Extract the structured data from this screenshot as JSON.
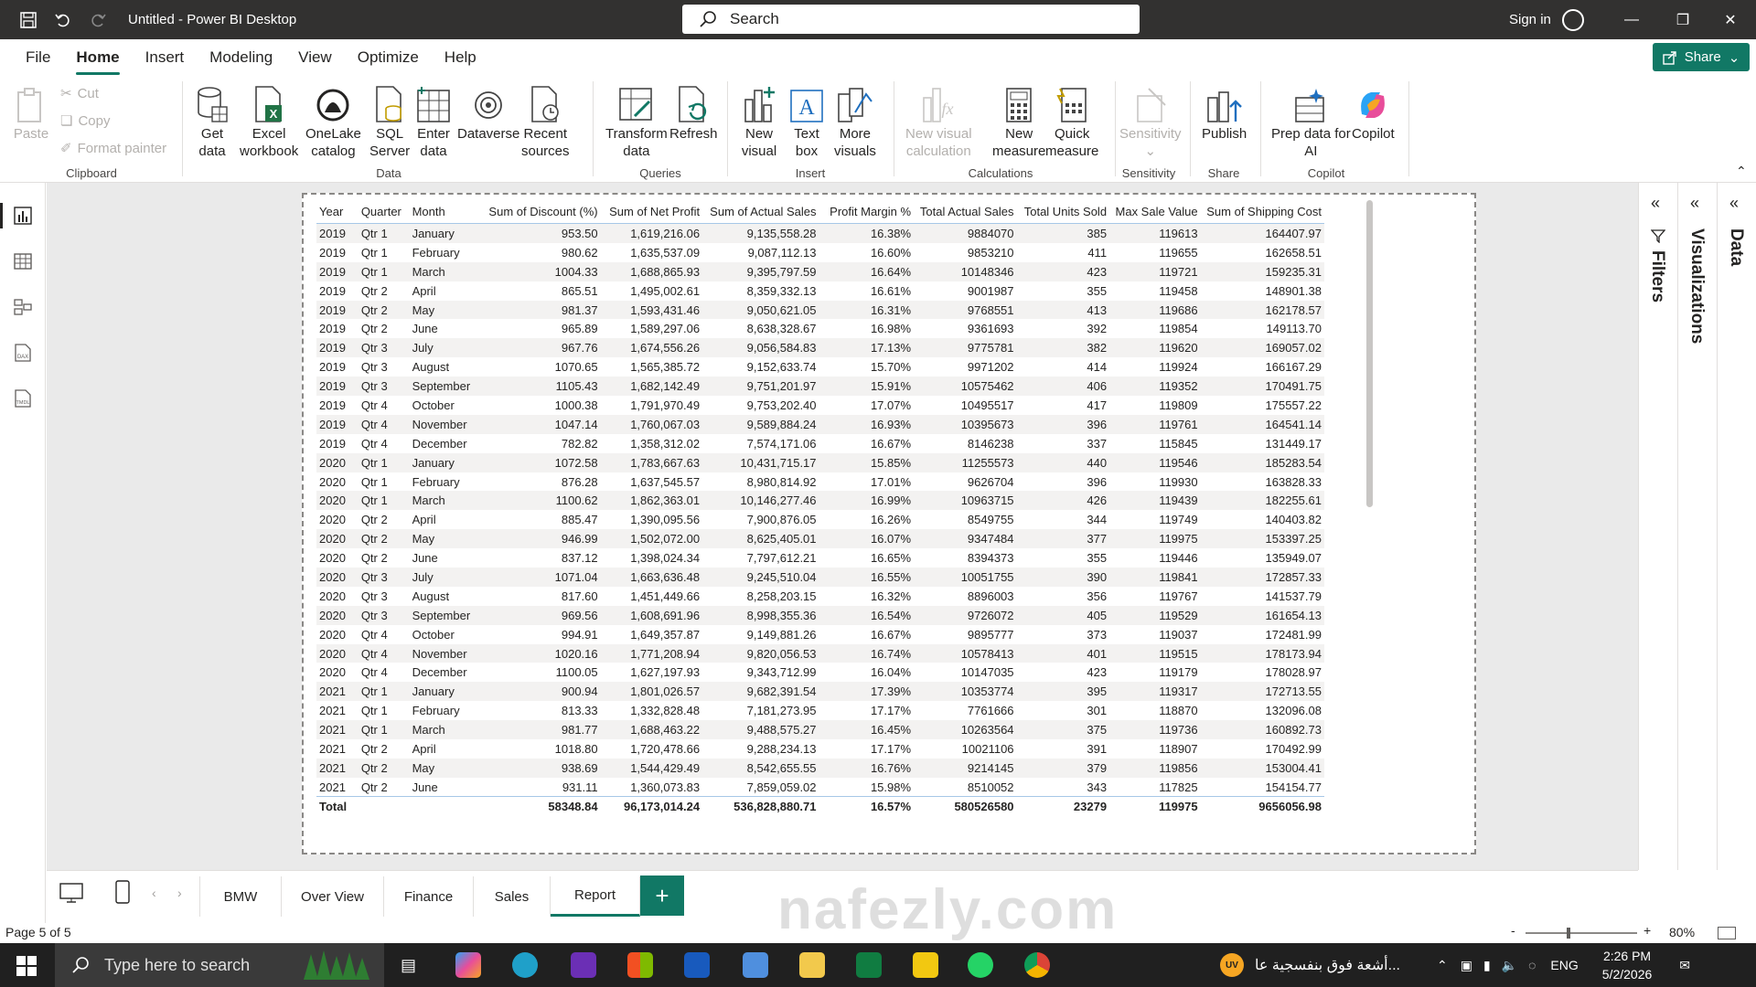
{
  "titlebar": {
    "title": "Untitled - Power BI Desktop",
    "search_placeholder": "Search",
    "signin": "Sign in"
  },
  "menu": {
    "items": [
      "File",
      "Home",
      "Insert",
      "Modeling",
      "View",
      "Optimize",
      "Help"
    ],
    "share": "Share"
  },
  "ribbon": {
    "clipboard": {
      "paste": "Paste",
      "cut": "Cut",
      "copy": "Copy",
      "format_painter": "Format painter",
      "label": "Clipboard"
    },
    "data": {
      "get_data": [
        "Get",
        "data"
      ],
      "excel": [
        "Excel",
        "workbook"
      ],
      "onelake": [
        "OneLake",
        "catalog"
      ],
      "sql": [
        "SQL",
        "Server"
      ],
      "enter": [
        "Enter",
        "data"
      ],
      "dataverse": "Dataverse",
      "recent": [
        "Recent",
        "sources"
      ],
      "label": "Data"
    },
    "queries": {
      "transform": [
        "Transform",
        "data"
      ],
      "refresh": "Refresh",
      "label": "Queries"
    },
    "insert": {
      "new_visual": [
        "New",
        "visual"
      ],
      "text_box": [
        "Text",
        "box"
      ],
      "more_visuals": [
        "More",
        "visuals"
      ],
      "label": "Insert"
    },
    "calculations": {
      "new_visual_calc": [
        "New visual",
        "calculation"
      ],
      "new_measure": [
        "New",
        "measure"
      ],
      "quick_measure": [
        "Quick",
        "measure"
      ],
      "label": "Calculations"
    },
    "sensitivity": {
      "btn": "Sensitivity",
      "label": "Sensitivity"
    },
    "share": {
      "publish": "Publish",
      "label": "Share"
    },
    "copilot": {
      "prep": [
        "Prep data for",
        "AI"
      ],
      "copilot": "Copilot",
      "label": "Copilot"
    }
  },
  "table": {
    "headers": [
      "Year",
      "Quarter",
      "Month",
      "Sum of Discount (%)",
      "Sum of Net Profit",
      "Sum of Actual Sales",
      "Profit Margin %",
      "Total Actual Sales",
      "Total Units Sold",
      "Max Sale Value",
      "Sum of Shipping Cost"
    ],
    "rows": [
      [
        "2019",
        "Qtr 1",
        "January",
        "953.50",
        "1,619,216.06",
        "9,135,558.28",
        "16.38%",
        "9884070",
        "385",
        "119613",
        "164407.97"
      ],
      [
        "2019",
        "Qtr 1",
        "February",
        "980.62",
        "1,635,537.09",
        "9,087,112.13",
        "16.60%",
        "9853210",
        "411",
        "119655",
        "162658.51"
      ],
      [
        "2019",
        "Qtr 1",
        "March",
        "1004.33",
        "1,688,865.93",
        "9,395,797.59",
        "16.64%",
        "10148346",
        "423",
        "119721",
        "159235.31"
      ],
      [
        "2019",
        "Qtr 2",
        "April",
        "865.51",
        "1,495,002.61",
        "8,359,332.13",
        "16.61%",
        "9001987",
        "355",
        "119458",
        "148901.38"
      ],
      [
        "2019",
        "Qtr 2",
        "May",
        "981.37",
        "1,593,431.46",
        "9,050,621.05",
        "16.31%",
        "9768551",
        "413",
        "119686",
        "162178.57"
      ],
      [
        "2019",
        "Qtr 2",
        "June",
        "965.89",
        "1,589,297.06",
        "8,638,328.67",
        "16.98%",
        "9361693",
        "392",
        "119854",
        "149113.70"
      ],
      [
        "2019",
        "Qtr 3",
        "July",
        "967.76",
        "1,674,556.26",
        "9,056,584.83",
        "17.13%",
        "9775781",
        "382",
        "119620",
        "169057.02"
      ],
      [
        "2019",
        "Qtr 3",
        "August",
        "1070.65",
        "1,565,385.72",
        "9,152,633.74",
        "15.70%",
        "9971202",
        "414",
        "119924",
        "166167.29"
      ],
      [
        "2019",
        "Qtr 3",
        "September",
        "1105.43",
        "1,682,142.49",
        "9,751,201.97",
        "15.91%",
        "10575462",
        "406",
        "119352",
        "170491.75"
      ],
      [
        "2019",
        "Qtr 4",
        "October",
        "1000.38",
        "1,791,970.49",
        "9,753,202.40",
        "17.07%",
        "10495517",
        "417",
        "119809",
        "175557.22"
      ],
      [
        "2019",
        "Qtr 4",
        "November",
        "1047.14",
        "1,760,067.03",
        "9,589,884.24",
        "16.93%",
        "10395673",
        "396",
        "119761",
        "164541.14"
      ],
      [
        "2019",
        "Qtr 4",
        "December",
        "782.82",
        "1,358,312.02",
        "7,574,171.06",
        "16.67%",
        "8146238",
        "337",
        "115845",
        "131449.17"
      ],
      [
        "2020",
        "Qtr 1",
        "January",
        "1072.58",
        "1,783,667.63",
        "10,431,715.17",
        "15.85%",
        "11255573",
        "440",
        "119546",
        "185283.54"
      ],
      [
        "2020",
        "Qtr 1",
        "February",
        "876.28",
        "1,637,545.57",
        "8,980,814.92",
        "17.01%",
        "9626704",
        "396",
        "119930",
        "163828.33"
      ],
      [
        "2020",
        "Qtr 1",
        "March",
        "1100.62",
        "1,862,363.01",
        "10,146,277.46",
        "16.99%",
        "10963715",
        "426",
        "119439",
        "182255.61"
      ],
      [
        "2020",
        "Qtr 2",
        "April",
        "885.47",
        "1,390,095.56",
        "7,900,876.05",
        "16.26%",
        "8549755",
        "344",
        "119749",
        "140403.82"
      ],
      [
        "2020",
        "Qtr 2",
        "May",
        "946.99",
        "1,502,072.00",
        "8,625,405.01",
        "16.07%",
        "9347484",
        "377",
        "119975",
        "153397.25"
      ],
      [
        "2020",
        "Qtr 2",
        "June",
        "837.12",
        "1,398,024.34",
        "7,797,612.21",
        "16.65%",
        "8394373",
        "355",
        "119446",
        "135949.07"
      ],
      [
        "2020",
        "Qtr 3",
        "July",
        "1071.04",
        "1,663,636.48",
        "9,245,510.04",
        "16.55%",
        "10051755",
        "390",
        "119841",
        "172857.33"
      ],
      [
        "2020",
        "Qtr 3",
        "August",
        "817.60",
        "1,451,449.66",
        "8,258,203.15",
        "16.32%",
        "8896003",
        "356",
        "119767",
        "141537.79"
      ],
      [
        "2020",
        "Qtr 3",
        "September",
        "969.56",
        "1,608,691.96",
        "8,998,355.36",
        "16.54%",
        "9726072",
        "405",
        "119529",
        "161654.13"
      ],
      [
        "2020",
        "Qtr 4",
        "October",
        "994.91",
        "1,649,357.87",
        "9,149,881.26",
        "16.67%",
        "9895777",
        "373",
        "119037",
        "172481.99"
      ],
      [
        "2020",
        "Qtr 4",
        "November",
        "1020.16",
        "1,771,208.94",
        "9,820,056.53",
        "16.74%",
        "10578413",
        "401",
        "119515",
        "178173.94"
      ],
      [
        "2020",
        "Qtr 4",
        "December",
        "1100.05",
        "1,627,197.93",
        "9,343,712.99",
        "16.04%",
        "10147035",
        "423",
        "119179",
        "178028.97"
      ],
      [
        "2021",
        "Qtr 1",
        "January",
        "900.94",
        "1,801,026.57",
        "9,682,391.54",
        "17.39%",
        "10353774",
        "395",
        "119317",
        "172713.55"
      ],
      [
        "2021",
        "Qtr 1",
        "February",
        "813.33",
        "1,332,828.48",
        "7,181,273.95",
        "17.17%",
        "7761666",
        "301",
        "118870",
        "132096.08"
      ],
      [
        "2021",
        "Qtr 1",
        "March",
        "981.77",
        "1,688,463.22",
        "9,488,575.27",
        "16.45%",
        "10263564",
        "375",
        "119736",
        "160892.73"
      ],
      [
        "2021",
        "Qtr 2",
        "April",
        "1018.80",
        "1,720,478.66",
        "9,288,234.13",
        "17.17%",
        "10021106",
        "391",
        "118907",
        "170492.99"
      ],
      [
        "2021",
        "Qtr 2",
        "May",
        "938.69",
        "1,544,429.49",
        "8,542,655.55",
        "16.76%",
        "9214145",
        "379",
        "119856",
        "153004.41"
      ],
      [
        "2021",
        "Qtr 2",
        "June",
        "931.11",
        "1,360,073.83",
        "7,859,059.02",
        "15.98%",
        "8510052",
        "343",
        "117825",
        "154154.77"
      ]
    ],
    "total": [
      "Total",
      "",
      "",
      "58348.84",
      "96,173,014.24",
      "536,828,880.71",
      "16.57%",
      "580526580",
      "23279",
      "119975",
      "9656056.98"
    ]
  },
  "panes": {
    "filters": "Filters",
    "visualizations": "Visualizations",
    "data": "Data"
  },
  "pages": [
    "BMW",
    "Over View",
    "Finance",
    "Sales",
    "Report"
  ],
  "active_page": "Report",
  "status": {
    "page": "Page 5 of 5",
    "zoom": "80%"
  },
  "taskbar": {
    "search": "Type here to search",
    "notification": "أشعة فوق بنفسجية عا...",
    "lang": "ENG",
    "time": "2:26 PM",
    "date": "5/2/2026",
    "badge": "UV"
  },
  "watermark": "nafezly.com",
  "colors": {
    "accent": "#117865",
    "titlebar": "#323130"
  }
}
